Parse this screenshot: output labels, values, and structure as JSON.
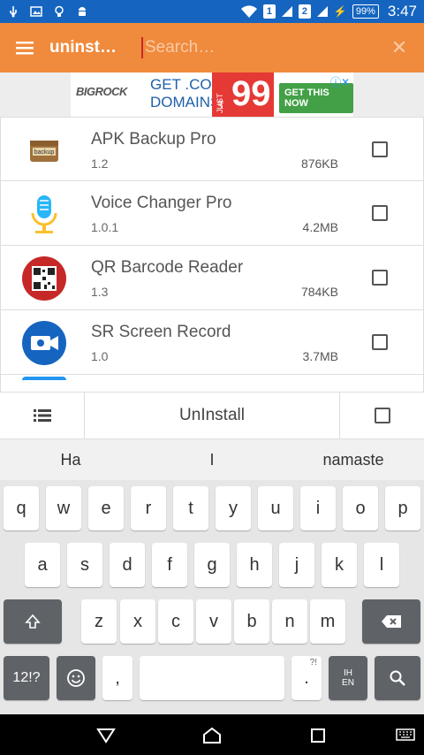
{
  "status": {
    "sim1": "1",
    "sim2": "2",
    "battery": "99%",
    "time": "3:47"
  },
  "toolbar": {
    "title": "uninst…",
    "search_placeholder": "Search…",
    "clear": "✕"
  },
  "ad": {
    "brand": "BIGROCK",
    "line1": "GET .COM",
    "line2": "DOMAINS",
    "just": "JUST",
    "rupee": "₹",
    "price": "99",
    "cta": "GET THIS NOW",
    "info": "ⓘ✕"
  },
  "apps": [
    {
      "name": "APK Backup Pro",
      "version": "1.2",
      "size": "876KB",
      "icon": "apk-backup-icon"
    },
    {
      "name": "Voice Changer Pro",
      "version": "1.0.1",
      "size": "4.2MB",
      "icon": "microphone-icon"
    },
    {
      "name": "QR Barcode Reader",
      "version": "1.3",
      "size": "784KB",
      "icon": "qr-code-icon"
    },
    {
      "name": "SR Screen Record",
      "version": "1.0",
      "size": "3.7MB",
      "icon": "camera-icon"
    }
  ],
  "actionbar": {
    "uninstall": "UnInstall"
  },
  "keyboard": {
    "suggestions": [
      "Ha",
      "I",
      "namaste"
    ],
    "row1": [
      "q",
      "w",
      "e",
      "r",
      "t",
      "y",
      "u",
      "i",
      "o",
      "p"
    ],
    "row2": [
      "a",
      "s",
      "d",
      "f",
      "g",
      "h",
      "j",
      "k",
      "l"
    ],
    "row3": [
      "z",
      "x",
      "c",
      "v",
      "b",
      "n",
      "m"
    ],
    "symbols": "12!?",
    "comma": ",",
    "period": ".",
    "period_hint": "?!",
    "lang_top": "IH",
    "lang_bottom": "EN"
  }
}
